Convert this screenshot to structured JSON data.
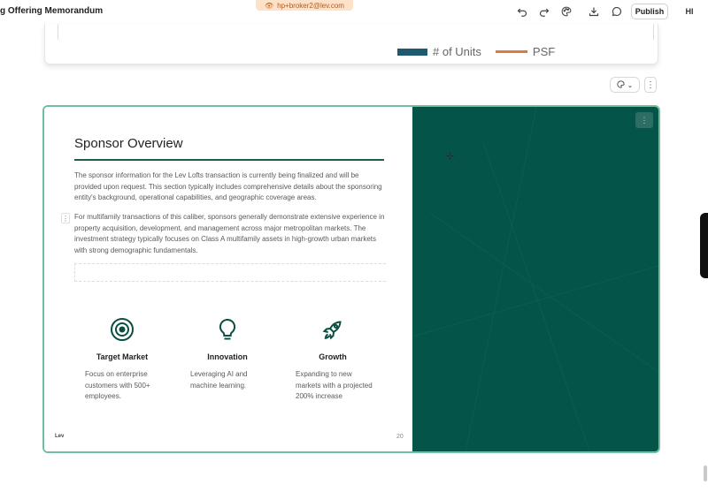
{
  "app": {
    "doc_title": "g Offering Memorandum",
    "user_email": "hp+broker2@lev.com",
    "publish_label": "Publish",
    "avatar_initials": "HI"
  },
  "toolbar": {
    "icons": [
      "undo-icon",
      "redo-icon",
      "palette-icon",
      "download-icon",
      "comment-icon"
    ]
  },
  "prev_slide": {
    "legend": [
      {
        "label": "# of Units",
        "color": "#1d5a70"
      },
      {
        "label": "PSF",
        "color": "#e0793a"
      }
    ]
  },
  "slide": {
    "title": "Sponsor Overview",
    "paragraph_1": "The sponsor information for the Lev Lofts transaction is currently being finalized and will be provided upon request. This section typically includes comprehensive details about the sponsoring entity's background, operational capabilities, and geographic coverage areas.",
    "paragraph_2": "For multifamily transactions of this caliber, sponsors generally demonstrate extensive experience in property acquisition, development, and management across major metropolitan markets. The investment strategy typically focuses on Class A multifamily assets in high-growth urban markets with strong demographic fundamentals.",
    "features": [
      {
        "icon": "target-icon",
        "title": "Target Market",
        "body": "Focus on enterprise customers with 500+ employees."
      },
      {
        "icon": "lightbulb-icon",
        "title": "Innovation",
        "body": "Leveraging AI and machine learning."
      },
      {
        "icon": "rocket-icon",
        "title": "Growth",
        "body": "Expanding to new markets with a projected 200% increase"
      }
    ],
    "logo_text": "Lev",
    "page_number": "20",
    "accent_color": "#04544a"
  }
}
